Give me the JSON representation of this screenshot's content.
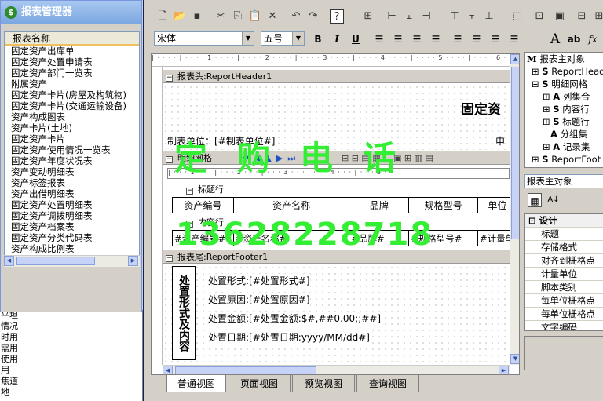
{
  "dialog": {
    "title": "报表管理器",
    "list_header": "报表名称",
    "items": [
      "固定资产出库单",
      "固定资产处置申请表",
      "固定资产部门一览表",
      "附属资产",
      "固定资产卡片(房屋及构筑物)",
      "固定资产卡片(交通运输设备)",
      "资产构成图表",
      "资产卡片(土地)",
      "固定资产卡片",
      "固定资产使用情况一览表",
      "固定资产年度状况表",
      "资产变动明细表",
      "资产标签报表",
      "资产出借明细表",
      "固定资产处置明细表",
      "固定资产调拨明细表",
      "固定资产档案表",
      "固定资产分类代码表",
      "资产构成比例表"
    ]
  },
  "background_list": [
    "平坦",
    "情况",
    "时用",
    "需用",
    "使用",
    "用",
    "焦道",
    "地"
  ],
  "font_toolbar": {
    "font_name": "宋体",
    "font_size": "五号",
    "bold": "B",
    "italic": "I",
    "underline": "U"
  },
  "designer": {
    "header_band": "报表头:ReportHeader1",
    "header_title": "固定资",
    "maker_label": "制表单位：[#制表单位#]",
    "maker_right": "申",
    "grid_band": "明细网格",
    "title_row_band": "标题行",
    "content_row_band": "内容行",
    "columns": [
      "资产编号",
      "资产名称",
      "品牌",
      "规格型号",
      "单位"
    ],
    "cells": [
      "#资产编号#",
      "#资产名称#",
      "#品牌#",
      "#规格型号#",
      "#计量单"
    ],
    "footer_band": "报表尾:ReportFooter1",
    "vertical_label": "处置形式及内容",
    "footer_lines": [
      "处置形式:[#处置形式#]",
      "处置原因:[#处置原因#]",
      "处置金额:[#处置金额:$#,##0.00;;##]",
      "处置日期:[#处置日期:yyyy/MM/dd#]"
    ]
  },
  "tabs": [
    "普通视图",
    "页面视图",
    "预览视图",
    "查询视图"
  ],
  "tree": {
    "root": "报表主对象",
    "items": [
      {
        "label": "ReportHead",
        "type": "S"
      },
      {
        "label": "明细网格",
        "type": "S"
      },
      {
        "label": "列集合",
        "type": "A"
      },
      {
        "label": "内容行",
        "type": "S"
      },
      {
        "label": "标题行",
        "type": "S"
      },
      {
        "label": "分组集",
        "type": "A"
      },
      {
        "label": "记录集",
        "type": "A"
      },
      {
        "label": "ReportFoot",
        "type": "S"
      }
    ]
  },
  "property_panel": {
    "object": "报表主对象",
    "category": "设计",
    "props": [
      "标题",
      "存储格式",
      "对齐到栅格点",
      "计量单位",
      "脚本类别",
      "每单位栅格点",
      "每单位栅格点",
      "文字编码"
    ]
  },
  "watermark": {
    "line1": "定购电话",
    "line2": "13628228718"
  }
}
